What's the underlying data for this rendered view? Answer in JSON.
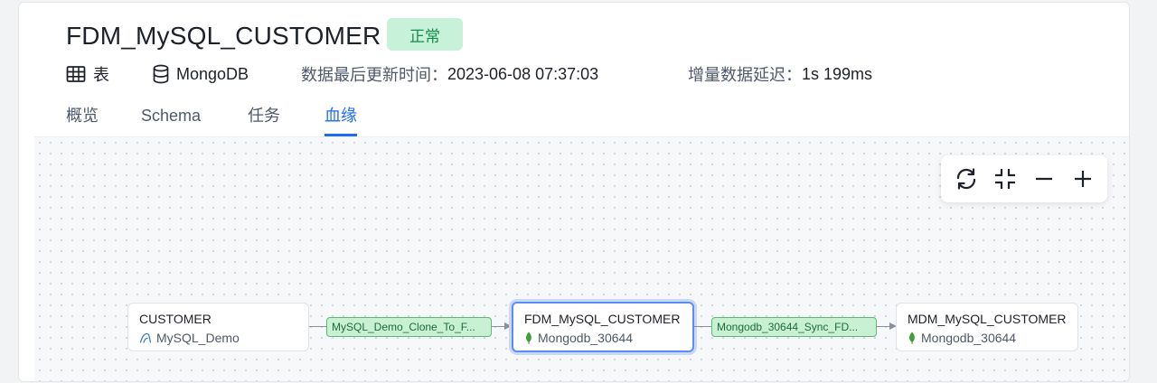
{
  "header": {
    "title": "FDM_MySQL_CUSTOMER",
    "status": "正常"
  },
  "meta": {
    "type_label": "表",
    "database_label": "MongoDB",
    "last_update_label": "数据最后更新时间：",
    "last_update_value": "2023-06-08 07:37:03",
    "delay_label": "增量数据延迟：",
    "delay_value": "1s 199ms"
  },
  "tabs": [
    {
      "label": "概览",
      "active": false
    },
    {
      "label": "Schema",
      "active": false
    },
    {
      "label": "任务",
      "active": false
    },
    {
      "label": "血缘",
      "active": true
    }
  ],
  "toolbar": {
    "icons": [
      "refresh-icon",
      "collapse-icon",
      "zoom-out-icon",
      "zoom-in-icon"
    ]
  },
  "lineage": {
    "nodes": [
      {
        "title": "CUSTOMER",
        "source": "MySQL_Demo",
        "source_icon": "mysql-icon"
      },
      {
        "title": "FDM_MySQL_CUSTOMER",
        "source": "Mongodb_30644",
        "source_icon": "mongodb-leaf-icon",
        "selected": true
      },
      {
        "title": "MDM_MySQL_CUSTOMER",
        "source": "Mongodb_30644",
        "source_icon": "mongodb-leaf-icon"
      }
    ],
    "edges": [
      {
        "label": "MySQL_Demo_Clone_To_F..."
      },
      {
        "label": "Mongodb_30644_Sync_FD..."
      }
    ]
  },
  "colors": {
    "accent": "#1d6bf0",
    "status_bg": "#c7f2d9",
    "status_text": "#178a4d",
    "edge_bg": "#c8f0d3",
    "mongodb_green": "#3fa037"
  }
}
